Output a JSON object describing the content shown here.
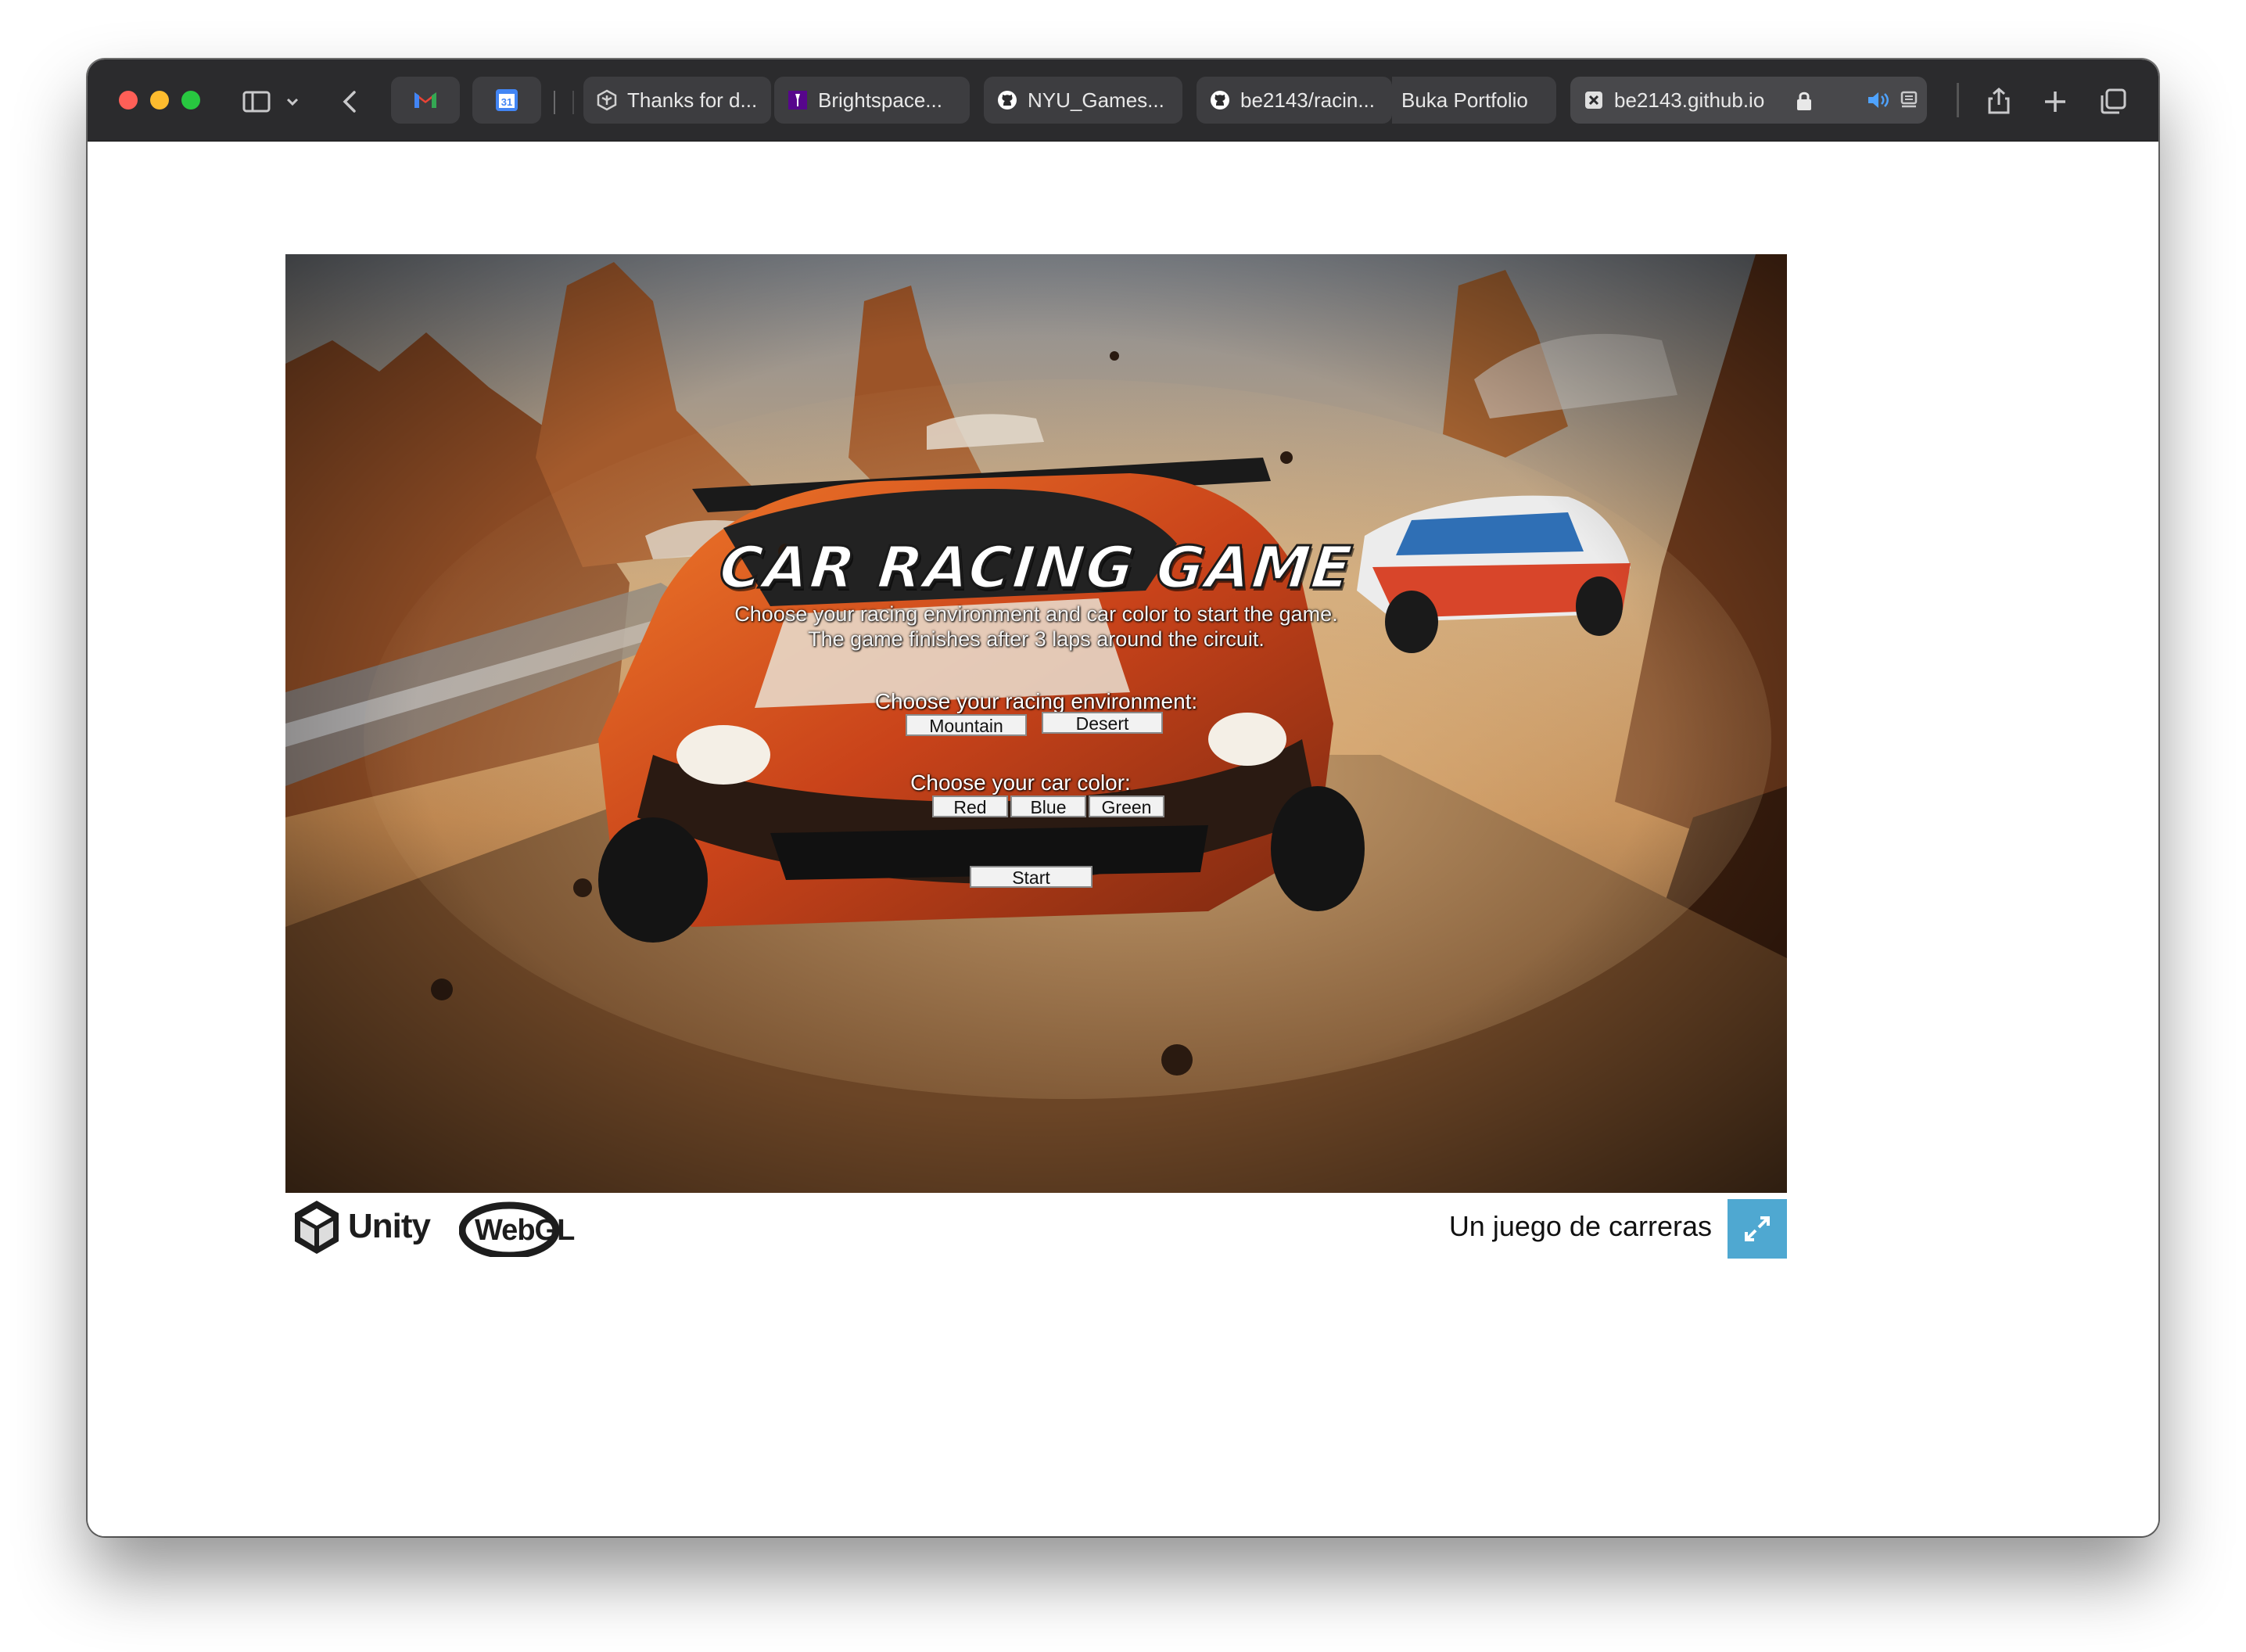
{
  "browser": {
    "tabs": [
      {
        "label": "Thanks for d...",
        "icon": "unity-icon"
      },
      {
        "label": "Brightspace...",
        "icon": "nyu-torch-icon"
      },
      {
        "label": "NYU_Games...",
        "icon": "github-icon"
      },
      {
        "label": "be2143/racin...",
        "icon": "github-icon"
      },
      {
        "label": "Buka Portfolio",
        "icon": ""
      },
      {
        "label": "be2143.github.io",
        "icon": "webpage-icon",
        "active": true
      }
    ],
    "pinned": [
      "gmail-icon",
      "calendar-icon"
    ],
    "calendar_day": "31"
  },
  "game": {
    "title": "CAR RACING GAME",
    "description": "Choose your racing environment and car color to start the game. The game finishes after 3 laps around the circuit.",
    "environment_label": "Choose your racing environment:",
    "environment_options": [
      "Mountain",
      "Desert"
    ],
    "color_label": "Choose your car color:",
    "color_options": [
      "Red",
      "Blue",
      "Green"
    ],
    "start_label": "Start"
  },
  "footer": {
    "unity_label": "Unity",
    "webgl_label": "WebGL",
    "game_name": "Un juego de carreras"
  },
  "colors": {
    "fullscreen_button": "#4fa8d1",
    "toolbar": "#2b2b2d"
  }
}
